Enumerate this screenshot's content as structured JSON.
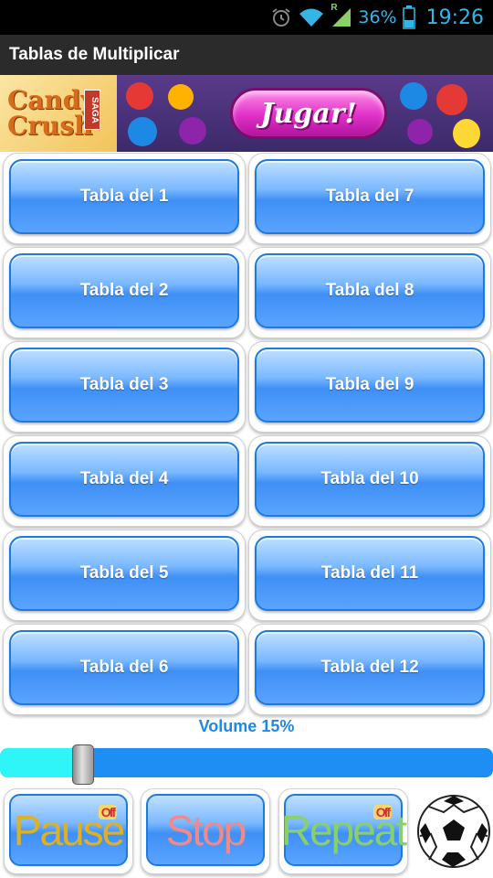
{
  "status_bar": {
    "battery_percent": "36%",
    "time": "19:26",
    "network_roaming": "R"
  },
  "app": {
    "title": "Tablas de Multiplicar"
  },
  "ad": {
    "logo_line1": "Candy",
    "logo_line2": "Crush",
    "logo_saga": "SAGA",
    "cta_label": "Jugar!"
  },
  "tables": [
    {
      "label": "Tabla del 1"
    },
    {
      "label": "Tabla del 7"
    },
    {
      "label": "Tabla del 2"
    },
    {
      "label": "Tabla del 8"
    },
    {
      "label": "Tabla del 3"
    },
    {
      "label": "Tabla del 9"
    },
    {
      "label": "Tabla del 4"
    },
    {
      "label": "Tabla del 10"
    },
    {
      "label": "Tabla del 5"
    },
    {
      "label": "Tabla del 11"
    },
    {
      "label": "Tabla del 6"
    },
    {
      "label": "Tabla del 12"
    }
  ],
  "volume": {
    "label": "Volume 15%",
    "level": 0.15
  },
  "controls": {
    "pause_label": "Pause",
    "pause_badge": "Off",
    "stop_label": "Stop",
    "repeat_label": "Repeat",
    "repeat_badge": "Off"
  },
  "colors": {
    "accent_blue": "#1e88e5",
    "button_blue": "#3f8ff5",
    "slider_fill": "#2ff5f8",
    "status_text": "#33b5e5"
  },
  "icons": {
    "alarm": "alarm-clock-icon",
    "wifi": "wifi-icon",
    "signal": "signal-icon",
    "battery": "battery-icon",
    "ball": "soccer-ball-icon"
  }
}
